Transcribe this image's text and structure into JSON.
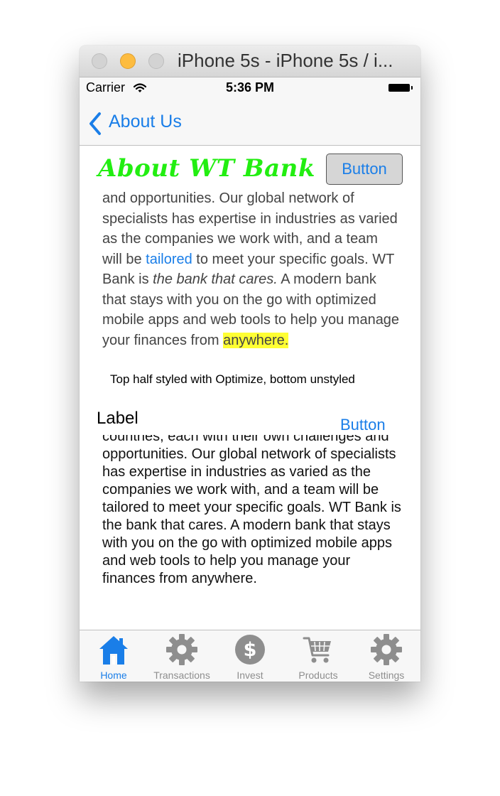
{
  "window": {
    "title": "iPhone 5s - iPhone 5s / i..."
  },
  "status_bar": {
    "carrier": "Carrier",
    "time": "5:36 PM"
  },
  "nav": {
    "back_label": "About Us"
  },
  "header": {
    "title": "About WT Bank",
    "button_label": "Button"
  },
  "styled_paragraph": {
    "part1": "and opportunities. Our global network of specialists has expertise in industries as varied as the companies we work with, and a team will be ",
    "link": "tailored",
    "part2": " to meet your specific goals. WT Bank is ",
    "italic": "the bank that cares.",
    "part3": " A modern bank that stays with you on the go with optimized mobile apps and web tools to help you manage your finances from ",
    "highlight": "anywhere."
  },
  "caption": "Top half styled with Optimize, bottom unstyled",
  "second_section": {
    "label": "Label",
    "button_label": "Button",
    "paragraph": "countries, each with their own challenges and opportunities. Our global network of specialists has expertise in industries as varied as the companies we work with, and a team will be tailored to meet your specific goals. WT Bank is the bank that cares. A modern bank that stays with you on the go with optimized mobile apps and web tools to help you manage your finances from anywhere."
  },
  "tabs": [
    {
      "label": "Home",
      "icon": "home-icon",
      "active": true
    },
    {
      "label": "Transactions",
      "icon": "gear-icon",
      "active": false
    },
    {
      "label": "Invest",
      "icon": "dollar-icon",
      "active": false
    },
    {
      "label": "Products",
      "icon": "cart-icon",
      "active": false
    },
    {
      "label": "Settings",
      "icon": "gear-icon",
      "active": false
    }
  ],
  "colors": {
    "accent": "#1a7ee8",
    "title_green": "#22ee11",
    "highlight": "#ffff33",
    "inactive_tab": "#8e8e8e"
  }
}
